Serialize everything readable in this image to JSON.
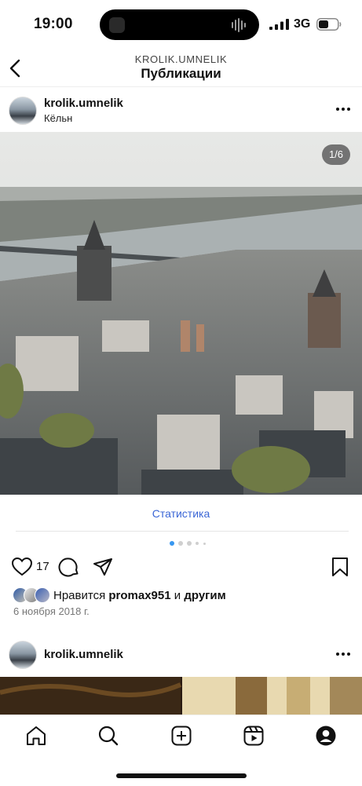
{
  "status_bar": {
    "time": "19:00",
    "network": "3G"
  },
  "header": {
    "username": "KROLIK.UMNELIK",
    "title": "Публикации"
  },
  "post": {
    "username": "krolik.umnelik",
    "location": "Кёльн",
    "image_counter": "1/6",
    "statistics_link": "Статистика",
    "carousel_total": 5,
    "carousel_active": 1,
    "likes_count": "17",
    "liked_by_prefix": "Нравится",
    "liked_by_user": "promax951",
    "liked_by_and": "и",
    "liked_by_others": "другим",
    "date": "6 ноября 2018 г."
  },
  "next_post": {
    "username": "krolik.umnelik"
  },
  "icons": {
    "back": "chevron-left-icon",
    "more": "more-horizontal-icon",
    "like": "heart-icon",
    "comment": "comment-icon",
    "share": "send-icon",
    "save": "bookmark-icon",
    "tab_home": "home-icon",
    "tab_search": "search-icon",
    "tab_create": "plus-square-icon",
    "tab_reels": "reels-icon",
    "tab_profile": "profile-icon"
  },
  "colors": {
    "link": "#3b66d6",
    "active_dot": "#3897f0"
  }
}
